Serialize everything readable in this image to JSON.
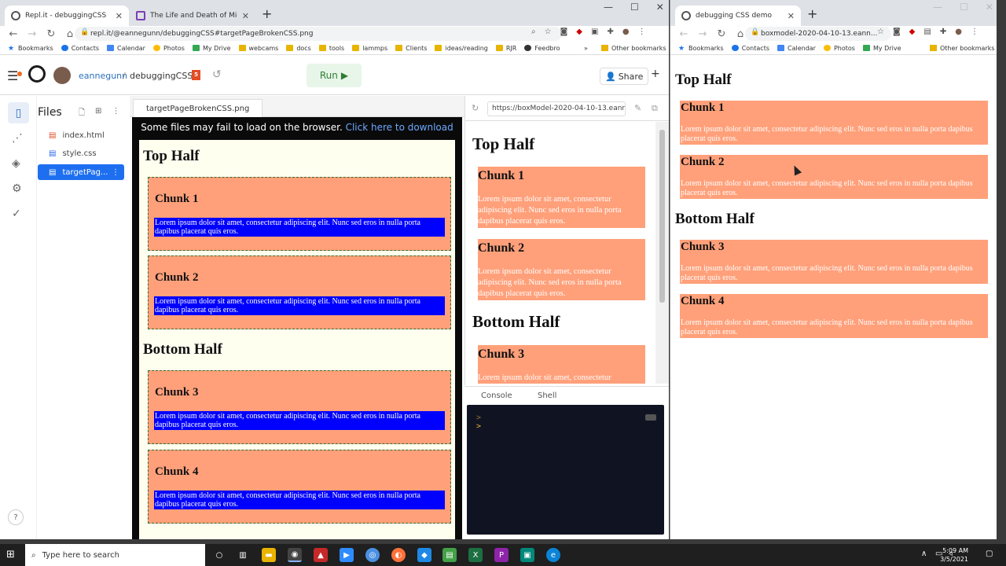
{
  "left_window": {
    "tabs": [
      {
        "title": "Repl.it - debuggingCSS",
        "active": true
      },
      {
        "title": "The Life and Death of Microsoft",
        "active": false
      }
    ],
    "url": "repl.it/@eannegunn/debuggingCSS#targetPageBrokenCSS.png",
    "bookmarks": [
      "Bookmarks",
      "Contacts",
      "Calendar",
      "Photos",
      "My Drive",
      "webcams",
      "docs",
      "tools",
      "lammps",
      "Clients",
      "ideas/reading",
      "RJR",
      "Feedbro"
    ],
    "more_bookmarks": "»",
    "other_bookmarks": "Other bookmarks"
  },
  "repl": {
    "username": "eannegunn",
    "project": "debuggingCSS",
    "run_label": "Run",
    "share_label": "Share",
    "files_title": "Files",
    "files": [
      {
        "name": "index.html",
        "selected": false
      },
      {
        "name": "style.css",
        "selected": false
      },
      {
        "name": "targetPag...",
        "selected": true
      }
    ],
    "editor_tab": "targetPageBrokenCSS.png",
    "notice_text": "Some files may fail to load on the browser.",
    "notice_link": "Click here to download",
    "webview_url": "https://boxModel-2020-04-10-13.eanr",
    "console_tab": "Console",
    "shell_tab": "Shell",
    "prompt_symbol": ">"
  },
  "page": {
    "top_half": "Top Half",
    "bottom_half": "Bottom Half",
    "lorem": "Lorem ipsum dolor sit amet, consectetur adipiscing elit. Nunc sed eros in nulla porta dapibus placerat quis eros.",
    "chunks": [
      "Chunk 1",
      "Chunk 2",
      "Chunk 3",
      "Chunk 4"
    ]
  },
  "right_window": {
    "tab_title": "debugging CSS demo",
    "url": "boxmodel-2020-04-10-13.eann...",
    "bookmarks": [
      "Bookmarks",
      "Contacts",
      "Calendar",
      "Photos",
      "My Drive"
    ],
    "other_bookmarks": "Other bookmarks"
  },
  "taskbar": {
    "search_placeholder": "Type here to search",
    "time": "5:09 AM",
    "date": "3/5/2021"
  },
  "colors": {
    "chunk_bg": "#ffa07a",
    "highlight_blue": "#0000ff",
    "accent": "#1e6ff0"
  }
}
